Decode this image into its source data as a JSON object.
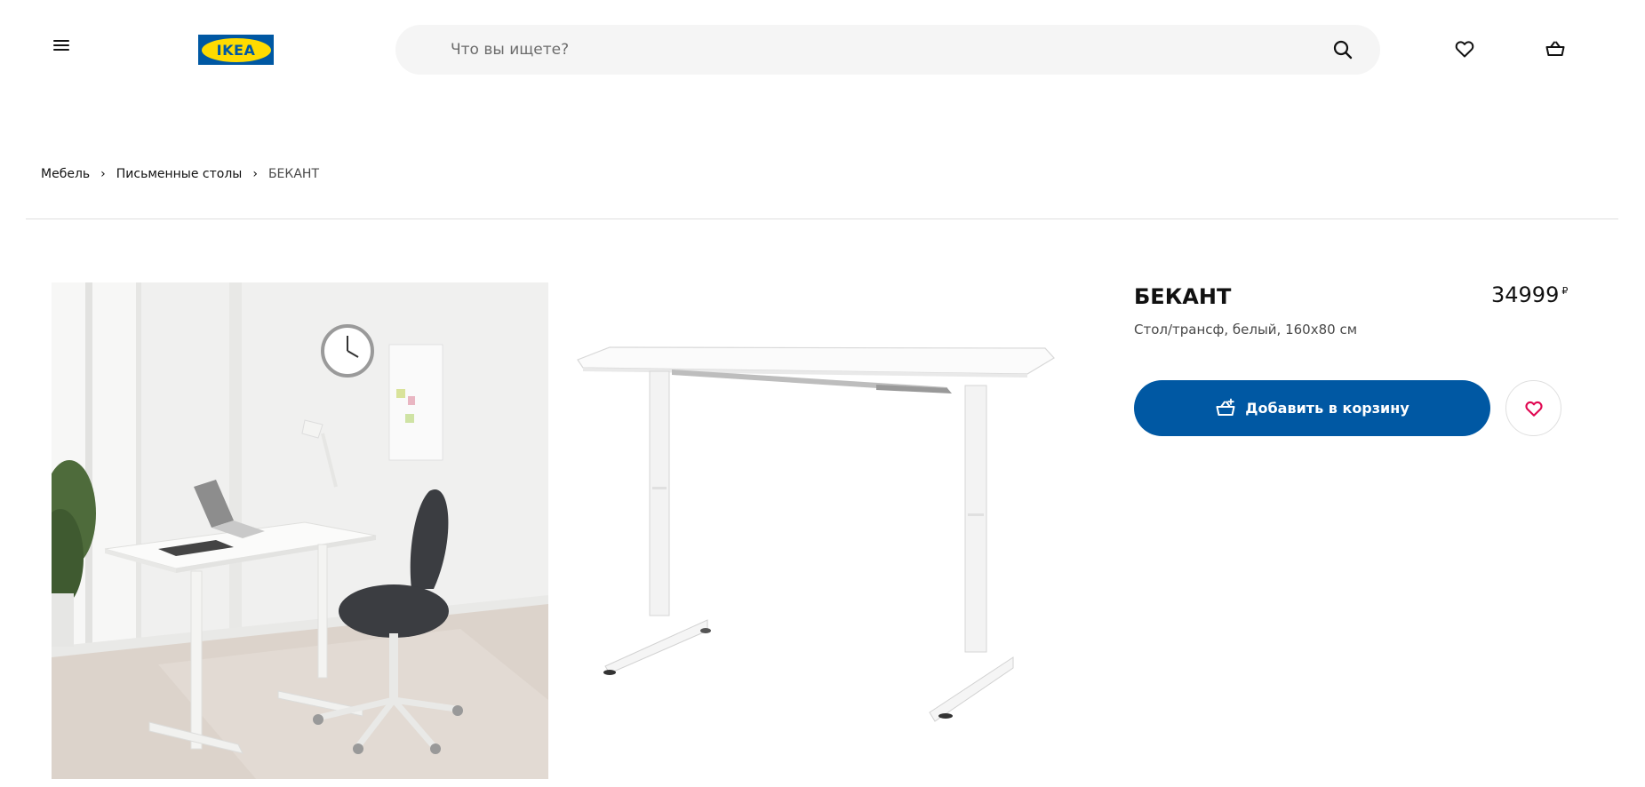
{
  "header": {
    "logo_text": "IKEA",
    "search": {
      "placeholder": "Что вы ищете?"
    },
    "icons": [
      "menu-icon",
      "search-icon",
      "heart-icon",
      "basket-icon"
    ]
  },
  "breadcrumb": {
    "items": [
      "Мебель",
      "Письменные столы",
      "БЕКАНТ"
    ],
    "separator": "›"
  },
  "product": {
    "name": "БЕКАНТ",
    "description": "Стол/трансф, белый, 160x80 см",
    "price": "34999",
    "currency": "₽",
    "add_to_cart_label": "Добавить в корзину"
  },
  "colors": {
    "brand_blue": "#0058a3",
    "brand_yellow": "#ffdb00",
    "favorite_red": "#e00751"
  }
}
